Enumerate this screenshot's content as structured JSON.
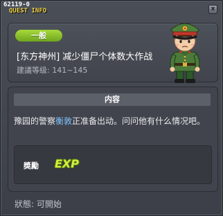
{
  "window": {
    "quest_id": "62119-0",
    "title": "QUEST INFO",
    "close_glyph": "x"
  },
  "quest": {
    "category": "一般",
    "name": "[东方神州] 减少僵尸个体数大作战",
    "level": "建議等级: 141~145",
    "npc_icon": "soldier-npc-portrait"
  },
  "content": {
    "header": "内容",
    "desc_before": "豫园的警察",
    "desc_highlight": "衡敦",
    "desc_after": "正准备出动。问问他有什么情况吧。"
  },
  "reward": {
    "label": "奬勵",
    "exp_icon_text": "EXP"
  },
  "status": "狀態: 可開始",
  "colors": {
    "tag_green": "#8cc22b",
    "title_yellow": "#f4d84b",
    "highlight_blue": "#7fc4ff",
    "exp_yellow": "#d8ec3d"
  }
}
